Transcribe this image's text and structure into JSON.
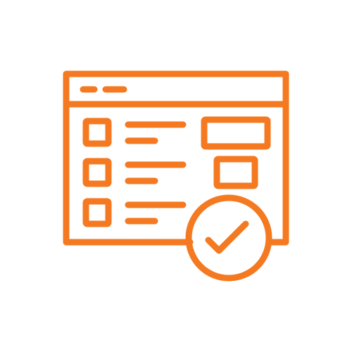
{
  "icon": {
    "name": "checklist-window-approved-icon",
    "stroke_color": "#f47920",
    "background_color": "#ffffff"
  },
  "checklist": {
    "rows": [
      {
        "checked": false
      },
      {
        "checked": false
      },
      {
        "checked": false
      }
    ]
  },
  "badge": {
    "icon": "checkmark-icon",
    "state": "approved"
  }
}
